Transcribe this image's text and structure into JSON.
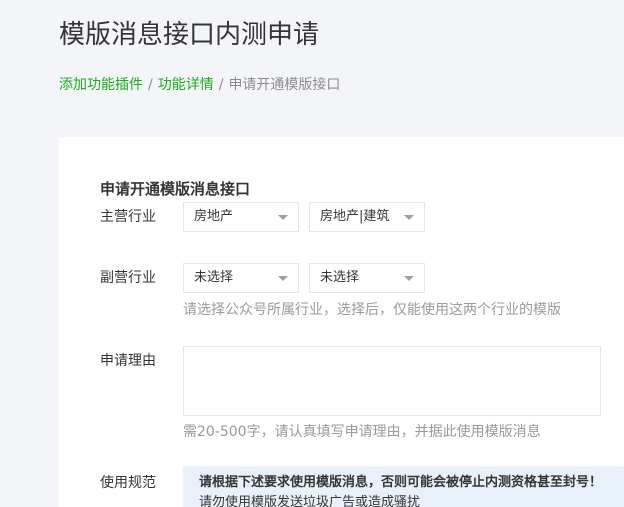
{
  "page": {
    "title": "模版消息接口内测申请"
  },
  "breadcrumb": {
    "items": [
      "添加功能插件",
      "功能详情",
      "申请开通模版接口"
    ],
    "separator": "/"
  },
  "form": {
    "section_title": "申请开通模版消息接口",
    "primary_industry": {
      "label": "主营行业",
      "select1_value": "房地产",
      "select2_value": "房地产|建筑"
    },
    "secondary_industry": {
      "label": "副营行业",
      "select1_value": "未选择",
      "select2_value": "未选择",
      "tip": "请选择公众号所属行业，选择后，仅能使用这两个行业的模版"
    },
    "reason": {
      "label": "申请理由",
      "value": "",
      "tip": "需20-500字，请认真填写申请理由，并据此使用模版消息"
    },
    "usage_rules": {
      "label": "使用规范",
      "notice_bold": "请根据下述要求使用模版消息，否则可能会被停止内测资格甚至封号！",
      "notice_line2": "请勿使用模版发送垃圾广告或造成骚扰"
    }
  },
  "colors": {
    "accent_green": "#1aad19",
    "notice_bg": "#e8f0fa",
    "page_bg": "#f4f5f9"
  }
}
